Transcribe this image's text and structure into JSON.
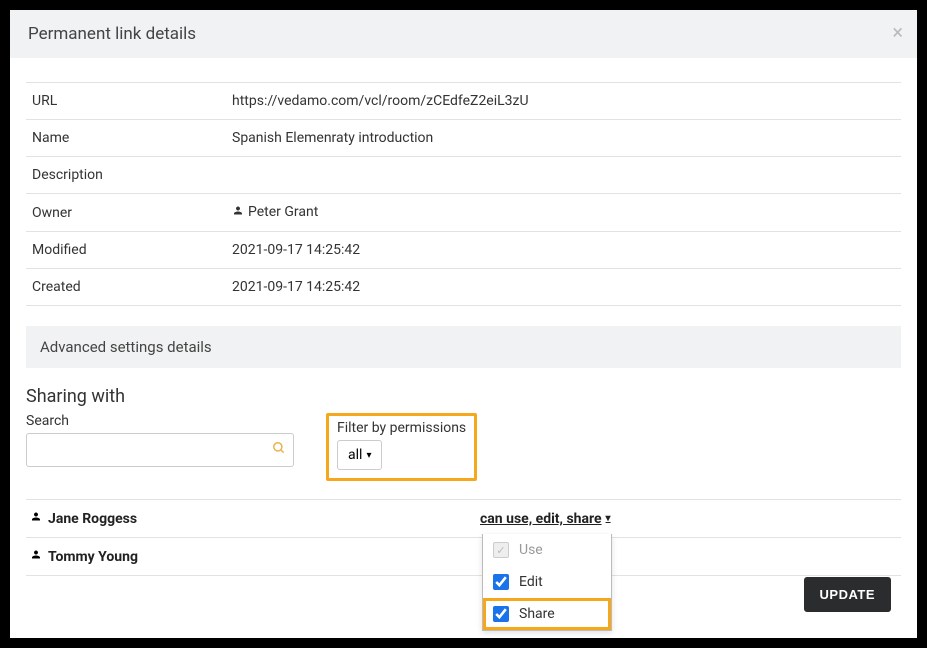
{
  "modal": {
    "title": "Permanent link details"
  },
  "details": {
    "url_label": "URL",
    "url_value": "https://vedamo.com/vcl/room/zCEdfeZ2eiL3zU",
    "name_label": "Name",
    "name_value": "Spanish Elemenraty introduction",
    "description_label": "Description",
    "description_value": "",
    "owner_label": "Owner",
    "owner_value": "Peter Grant",
    "modified_label": "Modified",
    "modified_value": "2021-09-17 14:25:42",
    "created_label": "Created",
    "created_value": "2021-09-17 14:25:42"
  },
  "advanced": {
    "title": "Advanced settings details"
  },
  "sharing": {
    "heading": "Sharing with",
    "search_label": "Search",
    "filter_label": "Filter by permissions",
    "filter_value": "all",
    "users": [
      {
        "name": "Jane Roggess",
        "perm_text": "can use, edit, share"
      },
      {
        "name": "Tommy Young",
        "perm_text": ""
      }
    ],
    "perm_options": {
      "use": "Use",
      "edit": "Edit",
      "share": "Share"
    }
  },
  "update_label": "UPDATE"
}
